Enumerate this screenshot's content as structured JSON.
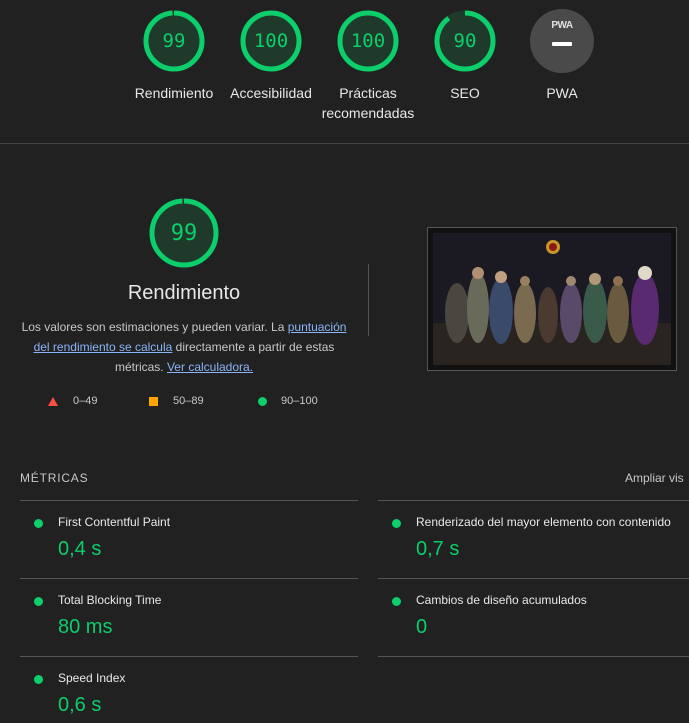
{
  "gauges": [
    {
      "label": "Rendimiento",
      "score": "99",
      "fraction": 0.99
    },
    {
      "label": "Accesibilidad",
      "score": "100",
      "fraction": 1.0
    },
    {
      "label": "Prácticas recomendadas",
      "score": "100",
      "fraction": 1.0
    },
    {
      "label": "SEO",
      "score": "90",
      "fraction": 0.9
    },
    {
      "label": "PWA",
      "badge_text": "PWA"
    }
  ],
  "performance": {
    "score": "99",
    "fraction": 0.99,
    "title": "Rendimiento",
    "desc_before": "Los valores son estimaciones y pueden variar. La ",
    "link_score": "puntuación del rendimiento se calcula",
    "desc_middle": " directamente a partir de estas métricas. ",
    "link_calc": "Ver calculadora."
  },
  "legend": {
    "fail": "0–49",
    "average": "50–89",
    "pass": "90–100"
  },
  "metrics": {
    "heading": "MÉTRICAS",
    "expand_label": "Ampliar vis",
    "items": [
      {
        "name": "First Contentful Paint",
        "value": "0,4 s"
      },
      {
        "name": "Renderizado del mayor elemento con contenido",
        "value": "0,7 s"
      },
      {
        "name": "Total Blocking Time",
        "value": "80 ms"
      },
      {
        "name": "Cambios de diseño acumulados",
        "value": "0"
      },
      {
        "name": "Speed Index",
        "value": "0,6 s"
      }
    ]
  },
  "colors": {
    "pass": "#0cce6b",
    "average": "#ffa400",
    "fail": "#ff4e42",
    "background": "#212121"
  }
}
